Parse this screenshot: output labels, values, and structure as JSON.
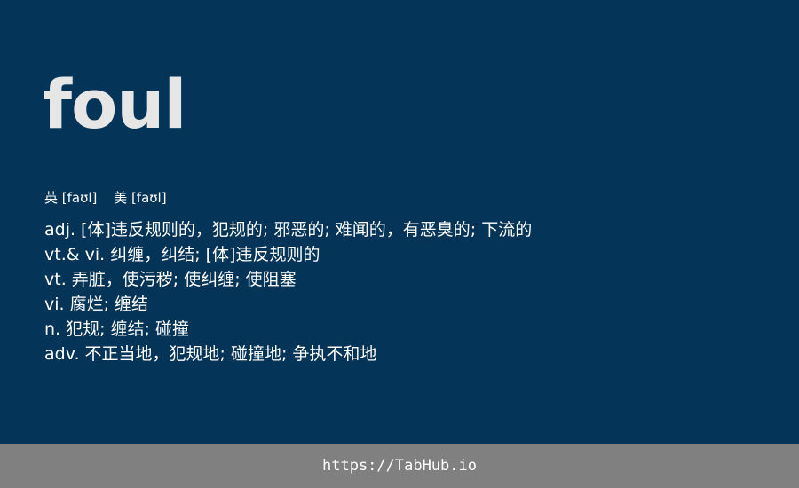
{
  "card": {
    "word": "foul",
    "phonetics": {
      "uk": "英 [faʊl]",
      "us": "美 [faʊl]"
    },
    "definitions": [
      "adj. [体]违反规则的，犯规的; 邪恶的; 难闻的，有恶臭的; 下流的",
      "vt.& vi. 纠缠，纠结; [体]违反规则的",
      "vt. 弄脏，使污秽; 使纠缠; 使阻塞",
      "vi. 腐烂; 缠结",
      "n. 犯规; 缠结; 碰撞",
      "adv. 不正当地，犯规地; 碰撞地; 争执不和地"
    ]
  },
  "footer": {
    "url": "https://TabHub.io"
  },
  "colors": {
    "card_background": "#043457",
    "footer_background": "#808080",
    "word_text": "#e6e6e6",
    "body_text": "#ffffff"
  }
}
